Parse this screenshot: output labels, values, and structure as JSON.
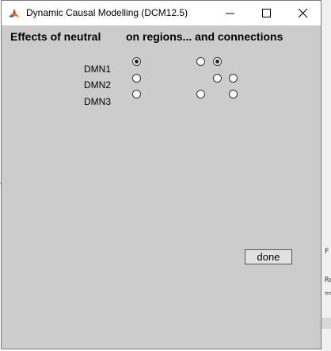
{
  "window": {
    "title": "Dynamic Causal Modelling (DCM12.5)"
  },
  "headings": {
    "effects": "Effects of neutral",
    "regions_connections": "on regions... and connections"
  },
  "rows": [
    {
      "label": "DMN1",
      "region_selected": true
    },
    {
      "label": "DMN2",
      "region_selected": false
    },
    {
      "label": "DMN3",
      "region_selected": false
    }
  ],
  "connections": {
    "row1": {
      "col1": false,
      "col2": true
    },
    "row2": {
      "col2": false,
      "col3": false
    },
    "row3": {
      "col1": false,
      "col3": false
    }
  },
  "buttons": {
    "done": "done"
  },
  "background_fragments": [
    "F",
    "Ro",
    "=="
  ],
  "colors": {
    "client_bg": "#cccccc",
    "titlebar_bg": "#ffffff"
  }
}
